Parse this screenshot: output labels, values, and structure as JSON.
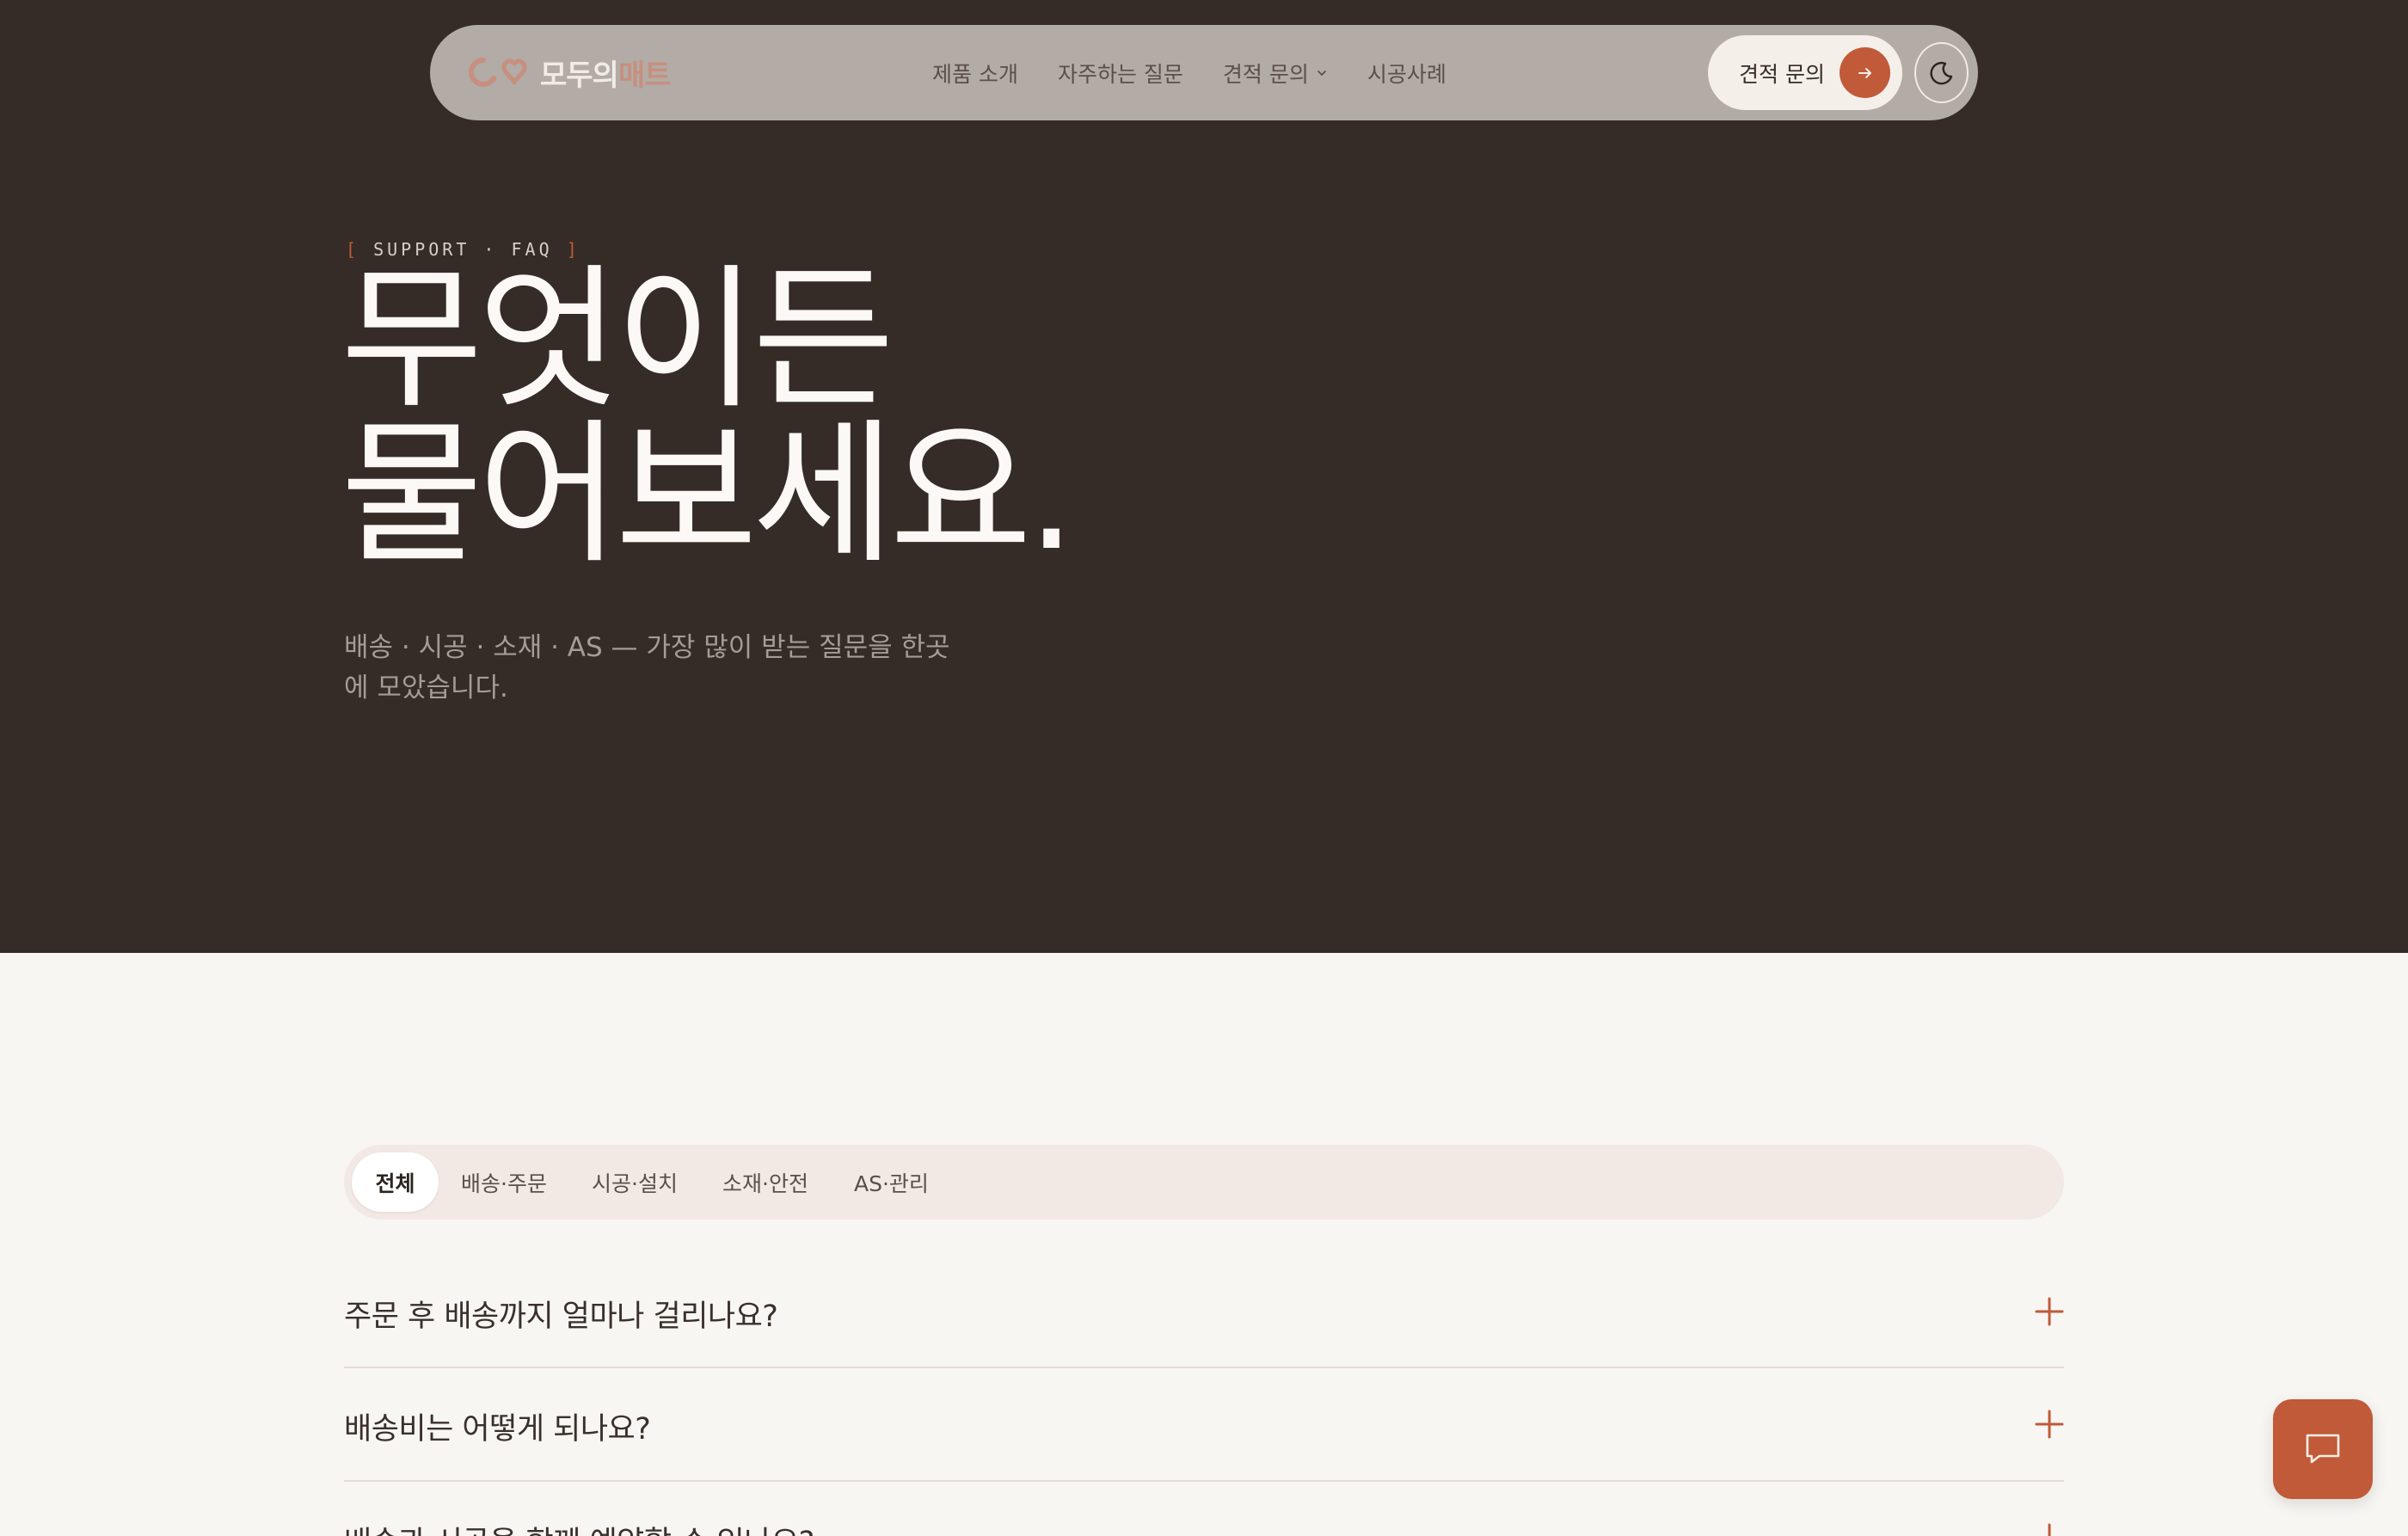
{
  "brand": {
    "logo_part1": "모두의",
    "logo_part2": "매트",
    "accent": "#c05a38",
    "hero_bg": "#352b27",
    "page_bg": "#f8f6f3"
  },
  "nav": {
    "items": [
      "제품 소개",
      "자주하는 질문",
      "견적 문의",
      "시공사례"
    ],
    "dropdown_item_index": 2,
    "cta_label": "견적 문의",
    "cta_icon": "arrow-right-icon",
    "theme_icon": "moon-icon"
  },
  "hero": {
    "eyebrow_open": "[",
    "eyebrow_text": "SUPPORT · FAQ",
    "eyebrow_close": "]",
    "title_line1": "무엇이든",
    "title_line2": "물어보세요.",
    "description": "배송 · 시공 · 소재 · AS — 가장 많이 받는 질문을 한곳에 모았습니다."
  },
  "tabs": {
    "items": [
      "전체",
      "배송·주문",
      "시공·설치",
      "소재·안전",
      "AS·관리"
    ],
    "active_index": 0
  },
  "faq": {
    "items": [
      "주문 후 배송까지 얼마나 걸리나요?",
      "배송비는 어떻게 되나요?",
      "배송과 시공을 함께 예약할 수 있나요?"
    ],
    "expand_icon": "plus-icon"
  },
  "chat": {
    "icon": "chat-bubble-icon"
  }
}
